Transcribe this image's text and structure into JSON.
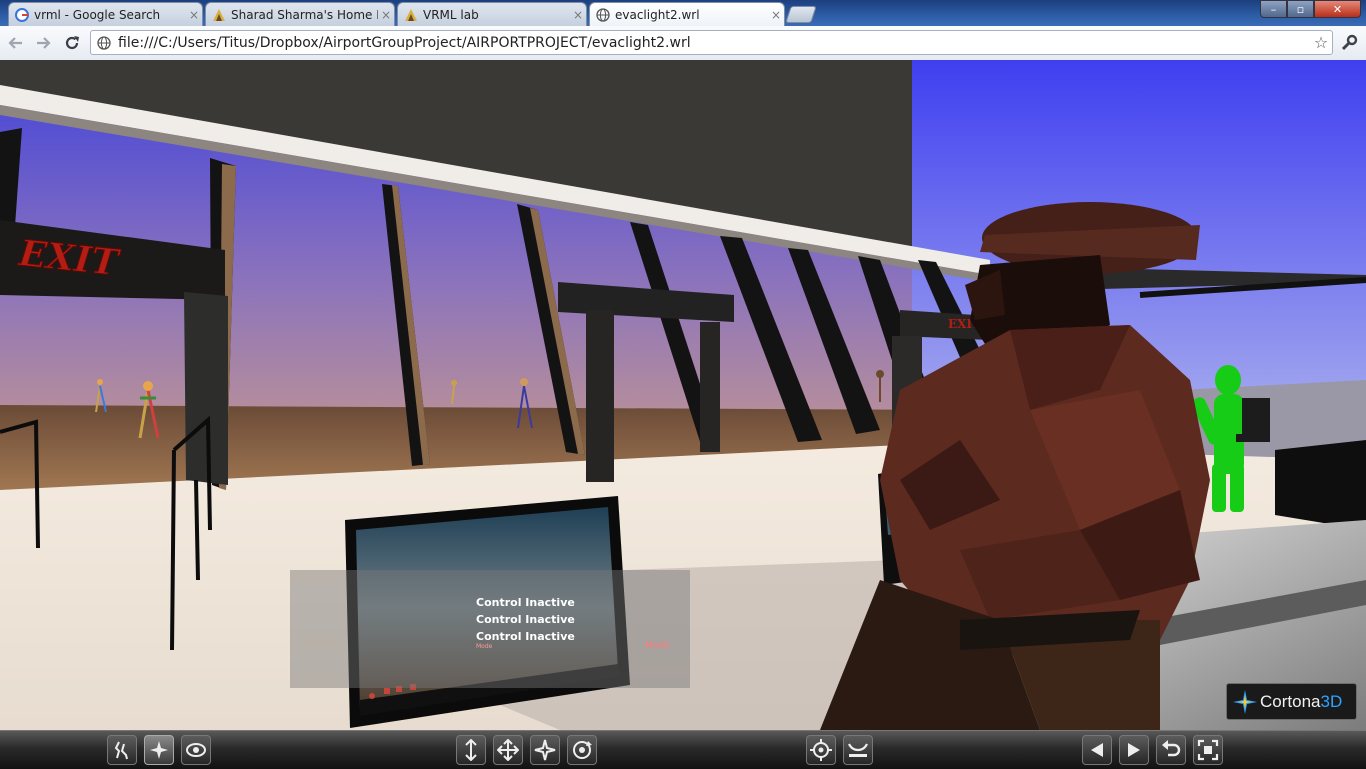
{
  "browser": {
    "tabs": [
      {
        "title": "vrml - Google Search",
        "favicon": "google-icon",
        "active": false
      },
      {
        "title": "Sharad Sharma's Home Pag",
        "favicon": "pencil-page-icon",
        "active": false
      },
      {
        "title": "VRML lab",
        "favicon": "pencil-page-icon",
        "active": false
      },
      {
        "title": "evaclight2.wrl",
        "favicon": "globe-icon",
        "active": true
      }
    ],
    "tab_close_glyph": "×",
    "address": "file:///C:/Users/Titus/Dropbox/AirportGroupProject/AIRPORTPROJECT/evaclight2.wrl",
    "window_buttons": {
      "minimize": "–",
      "maximize": "▫",
      "close": "✕"
    }
  },
  "scene": {
    "exit_sign_text": "EXIT",
    "colors": {
      "sky_top": "#4f4fe6",
      "sky_mid": "#8a6fc0",
      "wall_dark": "#3a3937",
      "floor": "#f4ece2",
      "person_shirt": "#5a241c",
      "green_figure": "#16d116"
    }
  },
  "hud": {
    "lines": [
      "Control Inactive",
      "Control Inactive",
      "Control Inactive"
    ],
    "mode_small": "Mode",
    "mode_right": "Mode"
  },
  "cortona_logo": {
    "brand": "Cortona",
    "brand_suffix": "3D"
  },
  "controls": {
    "groups": [
      {
        "name": "navigation-modes",
        "buttons": [
          "walk-mode-icon",
          "fly-mode-icon",
          "study-mode-icon"
        ]
      },
      {
        "name": "movement",
        "buttons": [
          "plan-icon",
          "pan-icon",
          "turn-icon",
          "roll-icon"
        ]
      },
      {
        "name": "view",
        "buttons": [
          "goto-icon",
          "align-icon"
        ]
      },
      {
        "name": "viewpoints",
        "buttons": [
          "previous-viewpoint-icon",
          "next-viewpoint-icon",
          "restore-icon",
          "fit-icon"
        ]
      }
    ]
  }
}
